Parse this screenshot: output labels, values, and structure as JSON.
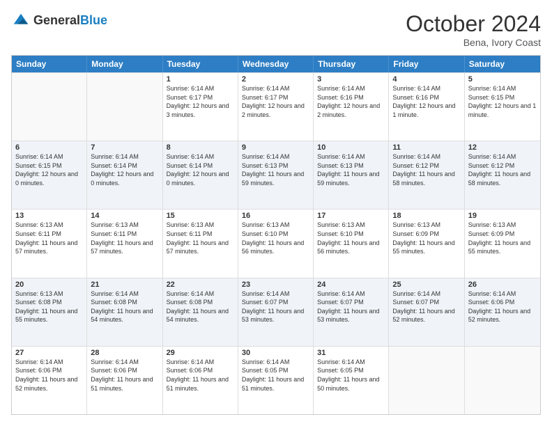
{
  "header": {
    "logo_general": "General",
    "logo_blue": "Blue",
    "title": "October 2024",
    "subtitle": "Bena, Ivory Coast"
  },
  "weekdays": [
    "Sunday",
    "Monday",
    "Tuesday",
    "Wednesday",
    "Thursday",
    "Friday",
    "Saturday"
  ],
  "rows": [
    [
      {
        "day": "",
        "info": "",
        "empty": true
      },
      {
        "day": "",
        "info": "",
        "empty": true
      },
      {
        "day": "1",
        "info": "Sunrise: 6:14 AM\nSunset: 6:17 PM\nDaylight: 12 hours and 3 minutes."
      },
      {
        "day": "2",
        "info": "Sunrise: 6:14 AM\nSunset: 6:17 PM\nDaylight: 12 hours and 2 minutes."
      },
      {
        "day": "3",
        "info": "Sunrise: 6:14 AM\nSunset: 6:16 PM\nDaylight: 12 hours and 2 minutes."
      },
      {
        "day": "4",
        "info": "Sunrise: 6:14 AM\nSunset: 6:16 PM\nDaylight: 12 hours and 1 minute."
      },
      {
        "day": "5",
        "info": "Sunrise: 6:14 AM\nSunset: 6:15 PM\nDaylight: 12 hours and 1 minute."
      }
    ],
    [
      {
        "day": "6",
        "info": "Sunrise: 6:14 AM\nSunset: 6:15 PM\nDaylight: 12 hours and 0 minutes.",
        "shaded": true
      },
      {
        "day": "7",
        "info": "Sunrise: 6:14 AM\nSunset: 6:14 PM\nDaylight: 12 hours and 0 minutes.",
        "shaded": true
      },
      {
        "day": "8",
        "info": "Sunrise: 6:14 AM\nSunset: 6:14 PM\nDaylight: 12 hours and 0 minutes.",
        "shaded": true
      },
      {
        "day": "9",
        "info": "Sunrise: 6:14 AM\nSunset: 6:13 PM\nDaylight: 11 hours and 59 minutes.",
        "shaded": true
      },
      {
        "day": "10",
        "info": "Sunrise: 6:14 AM\nSunset: 6:13 PM\nDaylight: 11 hours and 59 minutes.",
        "shaded": true
      },
      {
        "day": "11",
        "info": "Sunrise: 6:14 AM\nSunset: 6:12 PM\nDaylight: 11 hours and 58 minutes.",
        "shaded": true
      },
      {
        "day": "12",
        "info": "Sunrise: 6:14 AM\nSunset: 6:12 PM\nDaylight: 11 hours and 58 minutes.",
        "shaded": true
      }
    ],
    [
      {
        "day": "13",
        "info": "Sunrise: 6:13 AM\nSunset: 6:11 PM\nDaylight: 11 hours and 57 minutes."
      },
      {
        "day": "14",
        "info": "Sunrise: 6:13 AM\nSunset: 6:11 PM\nDaylight: 11 hours and 57 minutes."
      },
      {
        "day": "15",
        "info": "Sunrise: 6:13 AM\nSunset: 6:11 PM\nDaylight: 11 hours and 57 minutes."
      },
      {
        "day": "16",
        "info": "Sunrise: 6:13 AM\nSunset: 6:10 PM\nDaylight: 11 hours and 56 minutes."
      },
      {
        "day": "17",
        "info": "Sunrise: 6:13 AM\nSunset: 6:10 PM\nDaylight: 11 hours and 56 minutes."
      },
      {
        "day": "18",
        "info": "Sunrise: 6:13 AM\nSunset: 6:09 PM\nDaylight: 11 hours and 55 minutes."
      },
      {
        "day": "19",
        "info": "Sunrise: 6:13 AM\nSunset: 6:09 PM\nDaylight: 11 hours and 55 minutes."
      }
    ],
    [
      {
        "day": "20",
        "info": "Sunrise: 6:13 AM\nSunset: 6:08 PM\nDaylight: 11 hours and 55 minutes.",
        "shaded": true
      },
      {
        "day": "21",
        "info": "Sunrise: 6:14 AM\nSunset: 6:08 PM\nDaylight: 11 hours and 54 minutes.",
        "shaded": true
      },
      {
        "day": "22",
        "info": "Sunrise: 6:14 AM\nSunset: 6:08 PM\nDaylight: 11 hours and 54 minutes.",
        "shaded": true
      },
      {
        "day": "23",
        "info": "Sunrise: 6:14 AM\nSunset: 6:07 PM\nDaylight: 11 hours and 53 minutes.",
        "shaded": true
      },
      {
        "day": "24",
        "info": "Sunrise: 6:14 AM\nSunset: 6:07 PM\nDaylight: 11 hours and 53 minutes.",
        "shaded": true
      },
      {
        "day": "25",
        "info": "Sunrise: 6:14 AM\nSunset: 6:07 PM\nDaylight: 11 hours and 52 minutes.",
        "shaded": true
      },
      {
        "day": "26",
        "info": "Sunrise: 6:14 AM\nSunset: 6:06 PM\nDaylight: 11 hours and 52 minutes.",
        "shaded": true
      }
    ],
    [
      {
        "day": "27",
        "info": "Sunrise: 6:14 AM\nSunset: 6:06 PM\nDaylight: 11 hours and 52 minutes."
      },
      {
        "day": "28",
        "info": "Sunrise: 6:14 AM\nSunset: 6:06 PM\nDaylight: 11 hours and 51 minutes."
      },
      {
        "day": "29",
        "info": "Sunrise: 6:14 AM\nSunset: 6:06 PM\nDaylight: 11 hours and 51 minutes."
      },
      {
        "day": "30",
        "info": "Sunrise: 6:14 AM\nSunset: 6:05 PM\nDaylight: 11 hours and 51 minutes."
      },
      {
        "day": "31",
        "info": "Sunrise: 6:14 AM\nSunset: 6:05 PM\nDaylight: 11 hours and 50 minutes."
      },
      {
        "day": "",
        "info": "",
        "empty": true
      },
      {
        "day": "",
        "info": "",
        "empty": true
      }
    ]
  ]
}
